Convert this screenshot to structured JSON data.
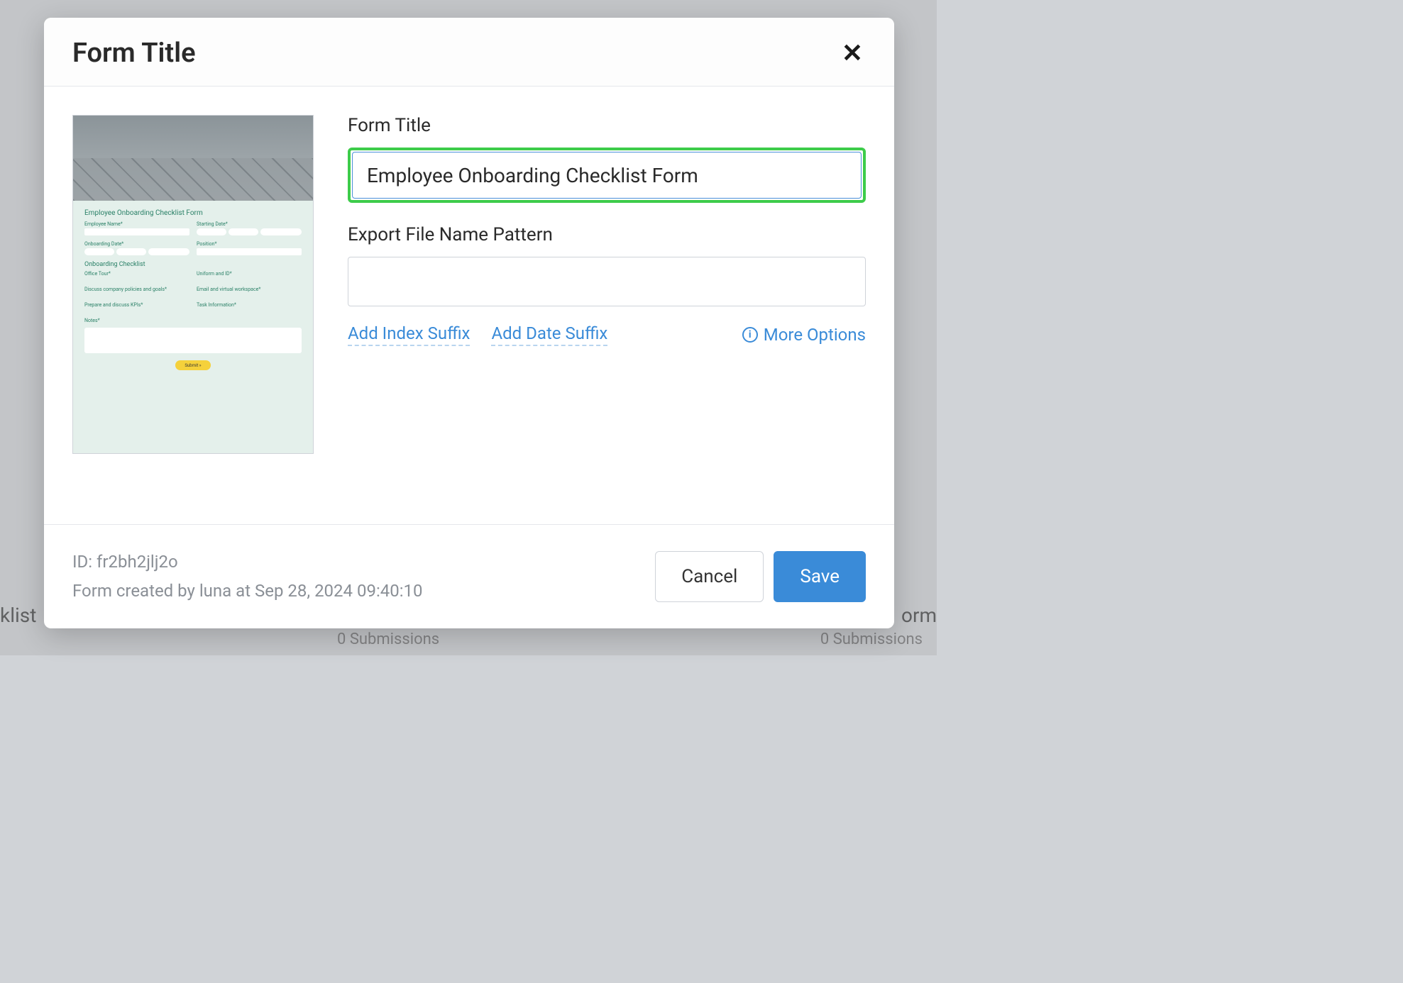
{
  "modal": {
    "title": "Form Title",
    "fields": {
      "form_title": {
        "label": "Form Title",
        "value": "Employee Onboarding Checklist Form"
      },
      "export_pattern": {
        "label": "Export File Name Pattern",
        "value": ""
      }
    },
    "links": {
      "add_index": "Add Index Suffix",
      "add_date": "Add Date Suffix",
      "more_options": "More Options"
    },
    "footer": {
      "id_line": "ID: fr2bh2jlj2o",
      "created_line": "Form created by luna at Sep 28, 2024 09:40:10",
      "cancel": "Cancel",
      "save": "Save"
    }
  },
  "preview": {
    "title": "Employee Onboarding Checklist Form",
    "employee_name": "Employee Name*",
    "starting_date": "Starting Date*",
    "onboarding_date": "Onboarding Date*",
    "position": "Position*",
    "section": "Onboarding Checklist",
    "office_tour": "Office Tour*",
    "uniform": "Uniform and ID*",
    "policies": "Discuss company policies and goals*",
    "email": "Email and virtual workspace*",
    "kpis": "Prepare and discuss KPIs*",
    "task_info": "Task Information*",
    "notes": "Notes*",
    "submit": "Submit  »"
  },
  "background": {
    "left_text": "klist",
    "right_text": "orm",
    "submissions": "0 Submissions"
  }
}
